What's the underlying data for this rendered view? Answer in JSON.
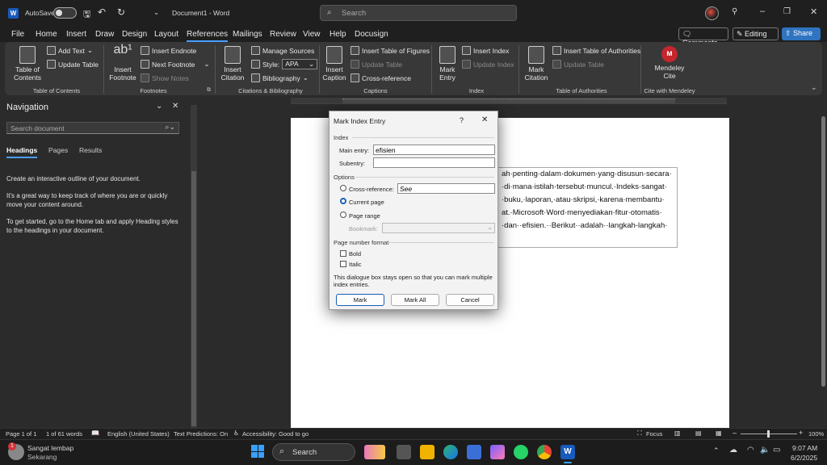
{
  "titlebar": {
    "autosave_label": "AutoSave",
    "autosave_state": "Off",
    "doc_title": "Document1 - Word",
    "search_placeholder": "Search"
  },
  "menu": {
    "items": [
      "File",
      "Home",
      "Insert",
      "Draw",
      "Design",
      "Layout",
      "References",
      "Mailings",
      "Review",
      "View",
      "Help",
      "Docusign"
    ],
    "active": "References",
    "comments_label": "Comments",
    "editing_label": "Editing",
    "share_label": "Share"
  },
  "ribbon": {
    "toc": {
      "big": "Table of\nContents",
      "add_text": "Add Text",
      "update_table": "Update Table",
      "group": "Table of Contents"
    },
    "footnotes": {
      "insert_footnote": "Insert\nFootnote",
      "insert_endnote": "Insert Endnote",
      "next_footnote": "Next Footnote",
      "show_notes": "Show Notes",
      "group": "Footnotes"
    },
    "citations": {
      "insert_citation": "Insert\nCitation",
      "manage_sources": "Manage Sources",
      "style_label": "Style:",
      "style_value": "APA",
      "bibliography": "Bibliography",
      "group": "Citations & Bibliography"
    },
    "captions": {
      "insert_caption": "Insert\nCaption",
      "insert_tof": "Insert Table of Figures",
      "update_table": "Update Table",
      "cross_reference": "Cross-reference",
      "group": "Captions"
    },
    "index": {
      "mark_entry": "Mark\nEntry",
      "insert_index": "Insert Index",
      "update_index": "Update Index",
      "group": "Index"
    },
    "toa": {
      "mark_citation": "Mark\nCitation",
      "insert_toa": "Insert Table of Authorities",
      "update_table": "Update Table",
      "group": "Table of Authorities"
    },
    "mendeley": {
      "label": "Mendeley\nCite",
      "group": "Cite with Mendeley"
    }
  },
  "navigation": {
    "title": "Navigation",
    "search_placeholder": "Search document",
    "tabs": [
      "Headings",
      "Pages",
      "Results"
    ],
    "active_tab": "Headings",
    "paragraphs": [
      "Create an interactive outline of your document.",
      "It's a great way to keep track of where you are or quickly move your content around.",
      "To get started, go to the Home tab and apply Heading styles to the headings in your document."
    ]
  },
  "document": {
    "lines": [
      "ah·penting·dalam·dokumen·yang·disusun·secara·",
      "·di·mana·istilah·tersebut·muncul.·Indeks·sangat·",
      "·buku,·laporan,·atau·skripsi,·karena·membantu·",
      "at.·Microsoft·Word·menyediakan·fitur·otomatis·",
      "·dan··efisien.··Berikut··adalah··langkah-langkah·"
    ]
  },
  "dialog": {
    "title": "Mark Index Entry",
    "help": "?",
    "section_index": "Index",
    "main_entry_label": "Main entry:",
    "main_entry_value": "efisien",
    "subentry_label": "Subentry:",
    "subentry_value": "",
    "section_options": "Options",
    "cross_reference_label": "Cross-reference:",
    "cross_reference_value": "See",
    "current_page_label": "Current page",
    "page_range_label": "Page range",
    "bookmark_label": "Bookmark:",
    "section_format": "Page number format",
    "bold_label": "Bold",
    "italic_label": "Italic",
    "note": "This dialogue box stays open so that you can mark multiple index entries.",
    "mark_button": "Mark",
    "mark_all_button": "Mark All",
    "cancel_button": "Cancel"
  },
  "statusbar": {
    "page": "Page 1 of 1",
    "words": "1 of 61 words",
    "language": "English (United States)",
    "text_predictions": "Text Predictions: On",
    "accessibility": "Accessibility: Good to go",
    "focus": "Focus",
    "zoom": "100%"
  },
  "taskbar": {
    "weather_title": "Sangat lembap",
    "weather_sub": "Sekarang",
    "notification_count": "1",
    "search_label": "Search",
    "time": "9:07 AM",
    "date": "6/2/2025"
  },
  "colors": {
    "accent": "#1a5fb4",
    "word_blue": "#185abd",
    "mendeley_red": "#c4262e"
  }
}
